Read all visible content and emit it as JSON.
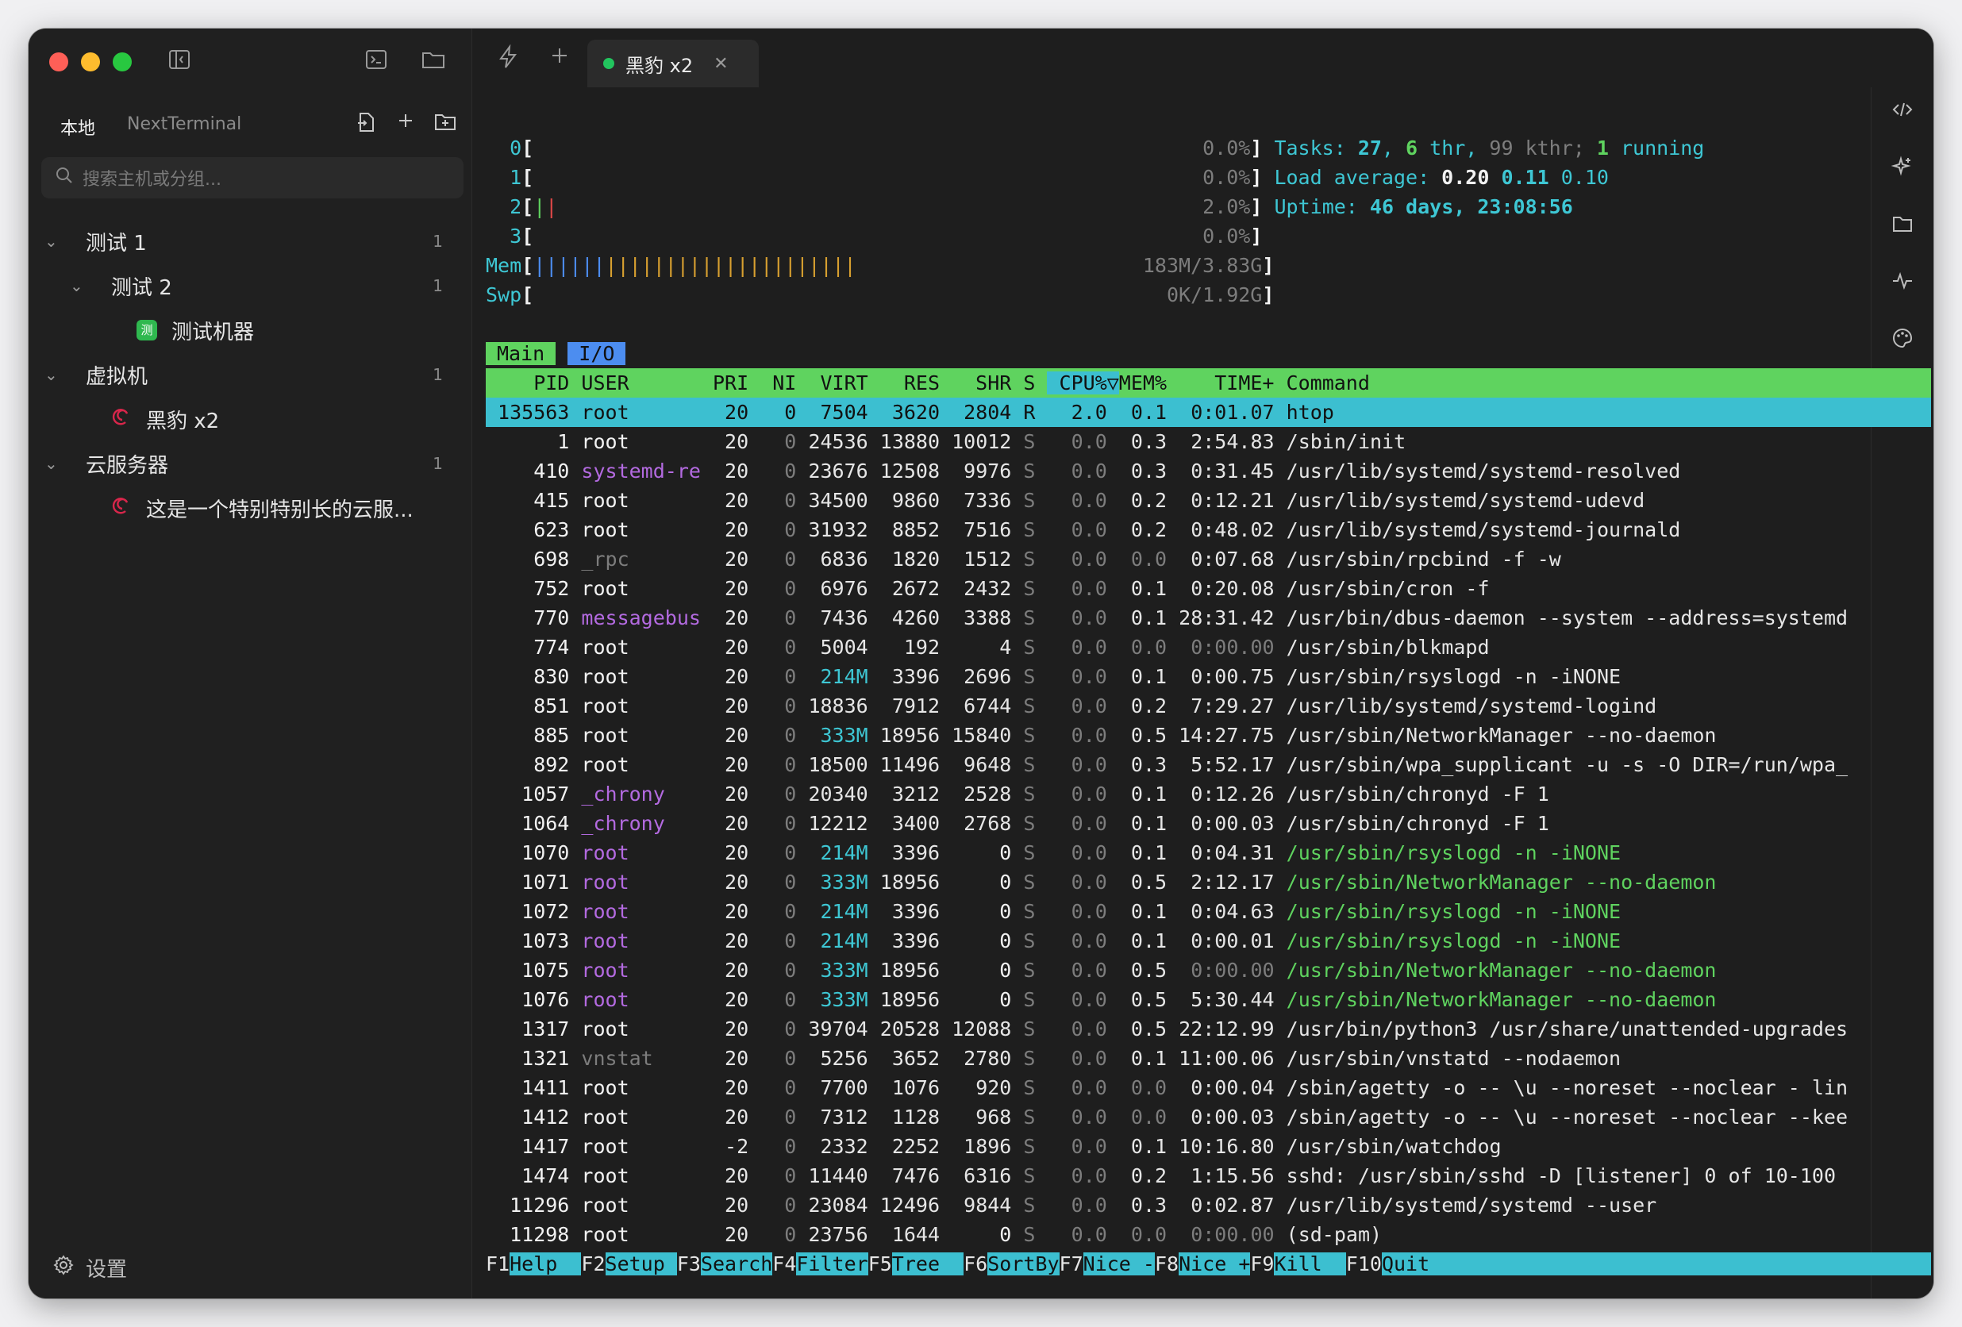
{
  "window": {
    "sidebar": {
      "tabs": [
        "本地",
        "NextTerminal"
      ],
      "search_placeholder": "搜索主机或分组...",
      "tree": [
        {
          "label": "测试 1",
          "count": "1",
          "level": 0,
          "kind": "group"
        },
        {
          "label": "测试 2",
          "count": "1",
          "level": 1,
          "kind": "group"
        },
        {
          "label": "测试机器",
          "count": "",
          "level": 2,
          "kind": "host-green",
          "badge": "测"
        },
        {
          "label": "虚拟机",
          "count": "1",
          "level": 0,
          "kind": "group"
        },
        {
          "label": "黑豹 x2",
          "count": "",
          "level": 1,
          "kind": "host-debian"
        },
        {
          "label": "云服务器",
          "count": "1",
          "level": 0,
          "kind": "group"
        },
        {
          "label": "这是一个特别特别长的云服...",
          "count": "",
          "level": 1,
          "kind": "host-debian"
        }
      ],
      "settings_label": "设置"
    },
    "tab": {
      "title": "黑豹 x2"
    }
  },
  "htop": {
    "cpus": [
      {
        "id": "0",
        "bar": "",
        "pct": "0.0%"
      },
      {
        "id": "1",
        "bar": "",
        "pct": "0.0%"
      },
      {
        "id": "2",
        "bar": "||",
        "pct": "2.0%"
      },
      {
        "id": "3",
        "bar": "",
        "pct": "0.0%"
      }
    ],
    "mem": {
      "label": "Mem",
      "value": "183M/3.83G"
    },
    "swp": {
      "label": "Swp",
      "value": "0K/1.92G"
    },
    "tasks": {
      "label": "Tasks: ",
      "total": "27",
      "thr": "6",
      "kthr": "99",
      "running": "1"
    },
    "load": {
      "label": "Load average: ",
      "v1": "0.20",
      "v5": "0.11",
      "v15": "0.10"
    },
    "uptime": {
      "label": "Uptime: ",
      "value": "46 days, 23:08:56"
    },
    "screen_tabs": [
      "Main",
      "I/O"
    ],
    "columns": [
      "PID",
      "USER",
      "PRI",
      "NI",
      "VIRT",
      "RES",
      "SHR",
      "S",
      "CPU%",
      "MEM%",
      "TIME+",
      "Command"
    ],
    "rows": [
      {
        "pid": "135563",
        "user": "root",
        "pri": "20",
        "ni": "0",
        "virt": "7504",
        "res": "3620",
        "shr": "2804",
        "s": "R",
        "cpu": "2.0",
        "mem": "0.1",
        "time": "0:01.07",
        "cmd": "htop"
      },
      {
        "pid": "1",
        "user": "root",
        "pri": "20",
        "ni": "0",
        "virt": "24536",
        "res": "13880",
        "shr": "10012",
        "s": "S",
        "cpu": "0.0",
        "mem": "0.3",
        "time": "2:54.83",
        "cmd": "/sbin/init"
      },
      {
        "pid": "410",
        "user": "systemd-re",
        "pri": "20",
        "ni": "0",
        "virt": "23676",
        "res": "12508",
        "shr": "9976",
        "s": "S",
        "cpu": "0.0",
        "mem": "0.3",
        "time": "0:31.45",
        "cmd": "/usr/lib/systemd/systemd-resolved"
      },
      {
        "pid": "415",
        "user": "root",
        "pri": "20",
        "ni": "0",
        "virt": "34500",
        "res": "9860",
        "shr": "7336",
        "s": "S",
        "cpu": "0.0",
        "mem": "0.2",
        "time": "0:12.21",
        "cmd": "/usr/lib/systemd/systemd-udevd"
      },
      {
        "pid": "623",
        "user": "root",
        "pri": "20",
        "ni": "0",
        "virt": "31932",
        "res": "8852",
        "shr": "7516",
        "s": "S",
        "cpu": "0.0",
        "mem": "0.2",
        "time": "0:48.02",
        "cmd": "/usr/lib/systemd/systemd-journald"
      },
      {
        "pid": "698",
        "user": "_rpc",
        "pri": "20",
        "ni": "0",
        "virt": "6836",
        "res": "1820",
        "shr": "1512",
        "s": "S",
        "cpu": "0.0",
        "mem": "0.0",
        "time": "0:07.68",
        "cmd": "/usr/sbin/rpcbind -f -w"
      },
      {
        "pid": "752",
        "user": "root",
        "pri": "20",
        "ni": "0",
        "virt": "6976",
        "res": "2672",
        "shr": "2432",
        "s": "S",
        "cpu": "0.0",
        "mem": "0.1",
        "time": "0:20.08",
        "cmd": "/usr/sbin/cron -f"
      },
      {
        "pid": "770",
        "user": "messagebus",
        "pri": "20",
        "ni": "0",
        "virt": "7436",
        "res": "4260",
        "shr": "3388",
        "s": "S",
        "cpu": "0.0",
        "mem": "0.1",
        "time": "28:31.42",
        "cmd": "/usr/bin/dbus-daemon --system --address=systemd"
      },
      {
        "pid": "774",
        "user": "root",
        "pri": "20",
        "ni": "0",
        "virt": "5004",
        "res": "192",
        "shr": "4",
        "s": "S",
        "cpu": "0.0",
        "mem": "0.0",
        "time": "0:00.00",
        "cmd": "/usr/sbin/blkmapd"
      },
      {
        "pid": "830",
        "user": "root",
        "pri": "20",
        "ni": "0",
        "virt": "214M",
        "res": "3396",
        "shr": "2696",
        "s": "S",
        "cpu": "0.0",
        "mem": "0.1",
        "time": "0:00.75",
        "cmd": "/usr/sbin/rsyslogd -n -iNONE"
      },
      {
        "pid": "851",
        "user": "root",
        "pri": "20",
        "ni": "0",
        "virt": "18836",
        "res": "7912",
        "shr": "6744",
        "s": "S",
        "cpu": "0.0",
        "mem": "0.2",
        "time": "7:29.27",
        "cmd": "/usr/lib/systemd/systemd-logind"
      },
      {
        "pid": "885",
        "user": "root",
        "pri": "20",
        "ni": "0",
        "virt": "333M",
        "res": "18956",
        "shr": "15840",
        "s": "S",
        "cpu": "0.0",
        "mem": "0.5",
        "time": "14:27.75",
        "cmd": "/usr/sbin/NetworkManager --no-daemon"
      },
      {
        "pid": "892",
        "user": "root",
        "pri": "20",
        "ni": "0",
        "virt": "18500",
        "res": "11496",
        "shr": "9648",
        "s": "S",
        "cpu": "0.0",
        "mem": "0.3",
        "time": "5:52.17",
        "cmd": "/usr/sbin/wpa_supplicant -u -s -O DIR=/run/wpa_"
      },
      {
        "pid": "1057",
        "user": "_chrony",
        "pri": "20",
        "ni": "0",
        "virt": "20340",
        "res": "3212",
        "shr": "2528",
        "s": "S",
        "cpu": "0.0",
        "mem": "0.1",
        "time": "0:12.26",
        "cmd": "/usr/sbin/chronyd -F 1"
      },
      {
        "pid": "1064",
        "user": "_chrony",
        "pri": "20",
        "ni": "0",
        "virt": "12212",
        "res": "3400",
        "shr": "2768",
        "s": "S",
        "cpu": "0.0",
        "mem": "0.1",
        "time": "0:00.03",
        "cmd": "/usr/sbin/chronyd -F 1"
      },
      {
        "pid": "1070",
        "user": "root",
        "pri": "20",
        "ni": "0",
        "virt": "214M",
        "res": "3396",
        "shr": "0",
        "s": "S",
        "cpu": "0.0",
        "mem": "0.1",
        "time": "0:04.31",
        "cmd": "/usr/sbin/rsyslogd -n -iNONE",
        "thread": true
      },
      {
        "pid": "1071",
        "user": "root",
        "pri": "20",
        "ni": "0",
        "virt": "333M",
        "res": "18956",
        "shr": "0",
        "s": "S",
        "cpu": "0.0",
        "mem": "0.5",
        "time": "2:12.17",
        "cmd": "/usr/sbin/NetworkManager --no-daemon",
        "thread": true
      },
      {
        "pid": "1072",
        "user": "root",
        "pri": "20",
        "ni": "0",
        "virt": "214M",
        "res": "3396",
        "shr": "0",
        "s": "S",
        "cpu": "0.0",
        "mem": "0.1",
        "time": "0:04.63",
        "cmd": "/usr/sbin/rsyslogd -n -iNONE",
        "thread": true
      },
      {
        "pid": "1073",
        "user": "root",
        "pri": "20",
        "ni": "0",
        "virt": "214M",
        "res": "3396",
        "shr": "0",
        "s": "S",
        "cpu": "0.0",
        "mem": "0.1",
        "time": "0:00.01",
        "cmd": "/usr/sbin/rsyslogd -n -iNONE",
        "thread": true
      },
      {
        "pid": "1075",
        "user": "root",
        "pri": "20",
        "ni": "0",
        "virt": "333M",
        "res": "18956",
        "shr": "0",
        "s": "S",
        "cpu": "0.0",
        "mem": "0.5",
        "time": "0:00.00",
        "cmd": "/usr/sbin/NetworkManager --no-daemon",
        "thread": true
      },
      {
        "pid": "1076",
        "user": "root",
        "pri": "20",
        "ni": "0",
        "virt": "333M",
        "res": "18956",
        "shr": "0",
        "s": "S",
        "cpu": "0.0",
        "mem": "0.5",
        "time": "5:30.44",
        "cmd": "/usr/sbin/NetworkManager --no-daemon",
        "thread": true
      },
      {
        "pid": "1317",
        "user": "root",
        "pri": "20",
        "ni": "0",
        "virt": "39704",
        "res": "20528",
        "shr": "12088",
        "s": "S",
        "cpu": "0.0",
        "mem": "0.5",
        "time": "22:12.99",
        "cmd": "/usr/bin/python3 /usr/share/unattended-upgrades"
      },
      {
        "pid": "1321",
        "user": "vnstat",
        "pri": "20",
        "ni": "0",
        "virt": "5256",
        "res": "3652",
        "shr": "2780",
        "s": "S",
        "cpu": "0.0",
        "mem": "0.1",
        "time": "11:00.06",
        "cmd": "/usr/sbin/vnstatd --nodaemon"
      },
      {
        "pid": "1411",
        "user": "root",
        "pri": "20",
        "ni": "0",
        "virt": "7700",
        "res": "1076",
        "shr": "920",
        "s": "S",
        "cpu": "0.0",
        "mem": "0.0",
        "time": "0:00.04",
        "cmd": "/sbin/agetty -o -- \\u --noreset --noclear - lin"
      },
      {
        "pid": "1412",
        "user": "root",
        "pri": "20",
        "ni": "0",
        "virt": "7312",
        "res": "1128",
        "shr": "968",
        "s": "S",
        "cpu": "0.0",
        "mem": "0.0",
        "time": "0:00.03",
        "cmd": "/sbin/agetty -o -- \\u --noreset --noclear --kee"
      },
      {
        "pid": "1417",
        "user": "root",
        "pri": "-2",
        "ni": "0",
        "virt": "2332",
        "res": "2252",
        "shr": "1896",
        "s": "S",
        "cpu": "0.0",
        "mem": "0.1",
        "time": "10:16.80",
        "cmd": "/usr/sbin/watchdog"
      },
      {
        "pid": "1474",
        "user": "root",
        "pri": "20",
        "ni": "0",
        "virt": "11440",
        "res": "7476",
        "shr": "6316",
        "s": "S",
        "cpu": "0.0",
        "mem": "0.2",
        "time": "1:15.56",
        "cmd": "sshd: /usr/sbin/sshd -D [listener] 0 of 10-100"
      },
      {
        "pid": "11296",
        "user": "root",
        "pri": "20",
        "ni": "0",
        "virt": "23084",
        "res": "12496",
        "shr": "9844",
        "s": "S",
        "cpu": "0.0",
        "mem": "0.3",
        "time": "0:02.87",
        "cmd": "/usr/lib/systemd/systemd --user"
      },
      {
        "pid": "11298",
        "user": "root",
        "pri": "20",
        "ni": "0",
        "virt": "23756",
        "res": "1644",
        "shr": "0",
        "s": "S",
        "cpu": "0.0",
        "mem": "0.0",
        "time": "0:00.00",
        "cmd": "(sd-pam)"
      }
    ],
    "fkeys": [
      {
        "key": "F1",
        "label": "Help  "
      },
      {
        "key": "F2",
        "label": "Setup "
      },
      {
        "key": "F3",
        "label": "Search"
      },
      {
        "key": "F4",
        "label": "Filter"
      },
      {
        "key": "F5",
        "label": "Tree  "
      },
      {
        "key": "F6",
        "label": "SortBy"
      },
      {
        "key": "F7",
        "label": "Nice -"
      },
      {
        "key": "F8",
        "label": "Nice +"
      },
      {
        "key": "F9",
        "label": "Kill  "
      },
      {
        "key": "F10",
        "label": "Quit                                          "
      }
    ]
  }
}
